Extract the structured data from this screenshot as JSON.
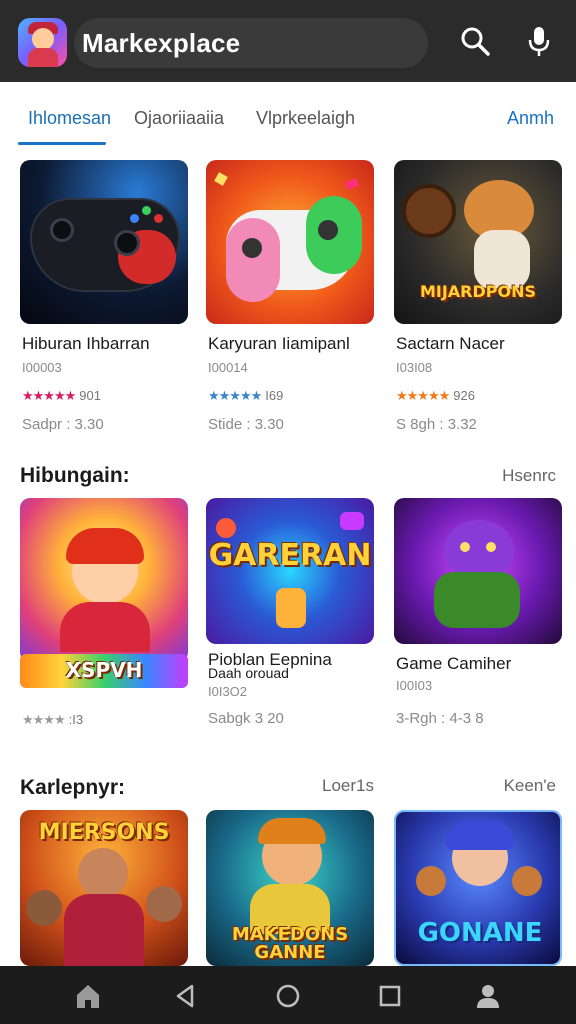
{
  "header": {
    "title": "Markexplace",
    "icons": [
      "app-icon",
      "search-icon",
      "mic-icon"
    ]
  },
  "tabs": {
    "items": [
      {
        "label": "Ihlomesan"
      },
      {
        "label": "Ojaoriiaaiia"
      },
      {
        "label": "Vlprkeelaigh"
      }
    ],
    "right_label": "Anmh"
  },
  "row1": [
    {
      "title": "Hiburan Ihbarran",
      "sub": "I00003",
      "stars": "★★★★★",
      "rating": "901",
      "meta": "Sadpr : 3.30",
      "art_text": ""
    },
    {
      "title": "Karyuran Iiamipanl",
      "sub": "I00014",
      "stars": "★★★★★",
      "rating": "I69",
      "meta": "Stide : 3.30",
      "art_text": ""
    },
    {
      "title": "Sactarn Nacer",
      "sub": "I03I08",
      "stars": "★★★★★",
      "rating": "926",
      "meta": "S 8gh : 3.32",
      "art_text": "MIJARDPONS"
    }
  ],
  "section2": {
    "title": "Hibungain:",
    "link": "Hsenrc"
  },
  "row2": [
    {
      "title": "",
      "sub": "",
      "stars": "★★★★",
      "rating": ":I3",
      "meta": "",
      "art_text": "XSPVH"
    },
    {
      "title": "Pioblan Eepnina",
      "title2": "Daah orouad",
      "sub": "I0I3O2",
      "stars": "",
      "rating": "",
      "meta": "Sabgk 3 20",
      "art_text": "GARERAN"
    },
    {
      "title": "Game Camiher",
      "sub": "I00I03",
      "stars": "",
      "rating": "",
      "meta": "3-Rgh : 4-3 8",
      "art_text": ""
    }
  ],
  "section3": {
    "title": "Karlepnyr:",
    "link": "Loer1s",
    "link2": "Keen'e"
  },
  "row3": [
    {
      "art_text": "MIERSONS"
    },
    {
      "art_text": "MAKEDONS GANNE"
    },
    {
      "art_text": "GONANE"
    }
  ],
  "colors": {
    "topbar": "#2b2b2b",
    "accent": "#1a73c8",
    "star_pink": "#d81b60",
    "star_blue": "#3a86c8",
    "star_orange": "#f07a1a",
    "star_gray": "#9a9a9a",
    "bottom_nav": "#1c1c1c"
  },
  "bottom_nav": [
    "home-icon",
    "back-icon",
    "home-circle-icon",
    "recents-icon",
    "profile-icon"
  ]
}
